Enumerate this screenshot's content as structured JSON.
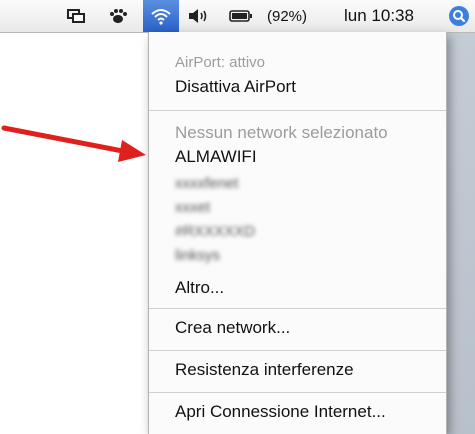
{
  "menubar": {
    "battery_percent": "(92%)",
    "clock": "lun 10:38",
    "icons": [
      "windows-icon",
      "paw-icon",
      "airport-wifi-icon",
      "volume-icon",
      "battery-icon",
      "spotlight-icon"
    ]
  },
  "airport_menu": {
    "status": "AirPort: attivo",
    "disable": "Disattiva AirPort",
    "no_network": "Nessun network selezionato",
    "networks": [
      "ALMAWIFI",
      "xxxxfenet",
      "xxxet",
      "#RXXXXXD",
      "linksys"
    ],
    "other": "Altro...",
    "create_network": "Crea network...",
    "interference": "Resistenza interferenze",
    "open_internet": "Apri Connessione Internet..."
  },
  "colors": {
    "highlight": "#2a62c9",
    "arrow": "#e0201c"
  }
}
